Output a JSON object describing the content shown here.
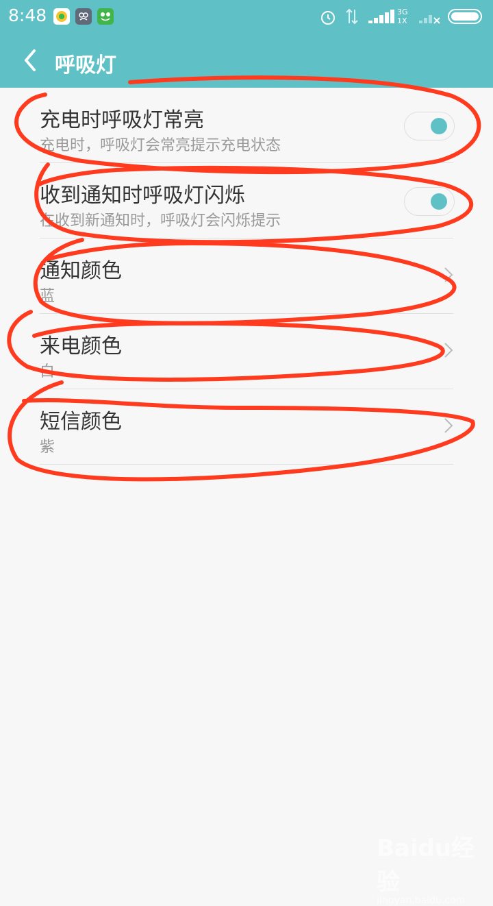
{
  "status": {
    "time": "8:48",
    "network": "3G",
    "network2": "1X"
  },
  "appbar": {
    "title": "呼吸灯"
  },
  "settings": [
    {
      "label": "充电时呼吸灯常亮",
      "sub": "充电时，呼吸灯会常亮提示充电状态",
      "type": "toggle",
      "on": true
    },
    {
      "label": "收到通知时呼吸灯闪烁",
      "sub": "在收到新通知时，呼吸灯会闪烁提示",
      "type": "toggle",
      "on": true
    },
    {
      "label": "通知颜色",
      "sub": "蓝",
      "type": "nav"
    },
    {
      "label": "来电颜色",
      "sub": "白",
      "type": "nav"
    },
    {
      "label": "短信颜色",
      "sub": "紫",
      "type": "nav"
    }
  ],
  "watermark": {
    "brand": "Baidu经验",
    "url": "jingyan.baidu.com"
  },
  "colors": {
    "accent": "#5fc1c6",
    "annotation": "#ff3b1f"
  }
}
